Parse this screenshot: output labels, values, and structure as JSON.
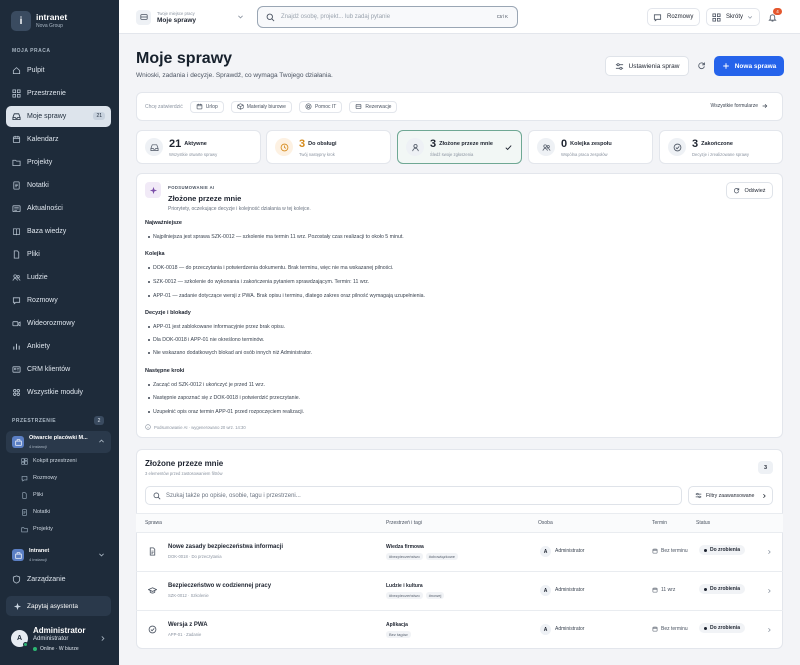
{
  "app": {
    "name": "intranet",
    "org": "Nova Group",
    "logo_letter": "i"
  },
  "sidebar": {
    "section_label": "MOJA PRACA",
    "items": [
      {
        "label": "Pulpit",
        "icon": "home-icon"
      },
      {
        "label": "Przestrzenie",
        "icon": "grid-icon"
      },
      {
        "label": "Moje sprawy",
        "icon": "inbox-icon",
        "count": "21",
        "active": true
      },
      {
        "label": "Kalendarz",
        "icon": "calendar-icon"
      },
      {
        "label": "Projekty",
        "icon": "folder-icon"
      },
      {
        "label": "Notatki",
        "icon": "note-icon"
      },
      {
        "label": "Aktualności",
        "icon": "news-icon"
      },
      {
        "label": "Baza wiedzy",
        "icon": "book-icon"
      },
      {
        "label": "Pliki",
        "icon": "file-icon"
      },
      {
        "label": "Ludzie",
        "icon": "people-icon"
      },
      {
        "label": "Rozmowy",
        "icon": "chat-icon"
      },
      {
        "label": "Wideorozmowy",
        "icon": "video-icon"
      },
      {
        "label": "Ankiety",
        "icon": "poll-icon"
      },
      {
        "label": "CRM klientów",
        "icon": "crm-icon"
      },
      {
        "label": "Wszystkie moduły",
        "icon": "modules-icon"
      }
    ],
    "spaces_label": "PRZESTRZENIE",
    "spaces_count": "2",
    "space1": {
      "name": "Otwarcie placówki M...",
      "instances": "4 instancji",
      "children": [
        "Kokpit przestrzeni",
        "Rozmowy",
        "Pliki",
        "Notatki",
        "Projekty"
      ]
    },
    "space2": {
      "name": "Intranet",
      "instances": "4 instancji"
    },
    "manage": "Zarządzanie",
    "assistant": "Zapytaj asystenta",
    "user": {
      "name": "Administrator",
      "role": "Administrator",
      "status": "Online · W biurze",
      "initial": "A"
    }
  },
  "topbar": {
    "workspace_label": "Twoje miejsce pracy",
    "workspace_value": "Moje sprawy",
    "search_placeholder": "Znajdź osobę, projekt... lub zadaj pytanie",
    "shortcut": "Ctrl K",
    "chats": "Rozmowy",
    "shortcuts": "Skróty",
    "notif_count": "4"
  },
  "page": {
    "title": "Moje sprawy",
    "subtitle": "Wnioski, zadania i decyzje. Sprawdź, co wymaga Twojego działania.",
    "settings_btn": "Ustawienia spraw",
    "new_btn": "Nowa sprawa"
  },
  "quick": {
    "label": "Chcę zatwierdzić",
    "chips": [
      "Urlop",
      "Materiały biurowe",
      "Pomoc IT",
      "Rezerwacje"
    ],
    "all_forms": "Wszystkie formularze"
  },
  "stats": [
    {
      "num": "21",
      "label": "Aktywne",
      "sub": "Wszystkie otwarte sprawy"
    },
    {
      "num": "3",
      "label": "Do obsługi",
      "sub": "Twój następny krok"
    },
    {
      "num": "3",
      "label": "Złożone przeze mnie",
      "sub": "Śledź swoje zgłoszenia"
    },
    {
      "num": "0",
      "label": "Kolejka zespołu",
      "sub": "Wspólna praca zespołów"
    },
    {
      "num": "3",
      "label": "Zakończone",
      "sub": "Decyzje i zrealizowane sprawy"
    }
  ],
  "ai": {
    "tag": "PODSUMOWANIE AI",
    "title": "Złożone przeze mnie",
    "subtitle": "Priorytety, oczekujące decyzje i kolejność działania w tej kolejce.",
    "refresh": "Odśwież",
    "sections": [
      {
        "heading": "Najważniejsze",
        "items": [
          "Najpilniejsza jest sprawa SZK-0012 — szkolenie ma termin 11 wrz. Pozostały czas realizacji to około 5 minut."
        ]
      },
      {
        "heading": "Kolejka",
        "items": [
          "DOK-0018 — do przeczytania i potwierdzenia dokumentu. Brak terminu, więc nie ma wskazanej pilności.",
          "SZK-0012 — szkolenie do wykonania i zakończenia pytaniem sprawdzającym. Termin: 11 wrz.",
          "APP-01 — zadanie dotyczące wersji z PWA. Brak opisu i terminu, dlatego zakres oraz pilność wymagają uzupełnienia."
        ]
      },
      {
        "heading": "Decyzje i blokady",
        "items": [
          "APP-01 jest zablokowane informacyjnie przez brak opisu.",
          "Dla DOK-0018 i APP-01 nie określono terminów.",
          "Nie wskazano dodatkowych blokad ani osób innych niż Administrator."
        ]
      },
      {
        "heading": "Następne kroki",
        "items": [
          "Zacząć od SZK-0012 i ukończyć je przed 11 wrz.",
          "Następnie zapoznać się z DOK-0018 i potwierdzić przeczytanie.",
          "Uzupełnić opis oraz termin APP-01 przed rozpoczęciem realizacji."
        ]
      }
    ],
    "footer": "Podsumowanie AI · wygenerowano 20 wrz. 14:30"
  },
  "list": {
    "title": "Złożone przeze mnie",
    "subtitle": "3 elementów przed zastosowaniem filtrów",
    "count": "3",
    "search_placeholder": "Szukaj także po opisie, osobie, tagu i przestrzeni...",
    "filters": "Filtry zaawansowane",
    "columns": [
      "Sprawa",
      "Przestrzeń i tagi",
      "Osoba",
      "Termin",
      "Status"
    ],
    "rows": [
      {
        "title": "Nowe zasady bezpieczeństwa informacji",
        "meta": "DOK-0018 · Do przeczytania",
        "space": "Wiedza firmowa",
        "tags": [
          "#bezpieczeństwo",
          "#obowiązkowe"
        ],
        "person": "Administrator",
        "initial": "A",
        "due": "Bez terminu",
        "status": "Do zrobienia",
        "icon": "document-icon"
      },
      {
        "title": "Bezpieczeństwo w codziennej pracy",
        "meta": "SZK-0012 · Szkolenie",
        "space": "Ludzie i kultura",
        "tags": [
          "#bezpieczeństwo",
          "#nowej"
        ],
        "person": "Administrator",
        "initial": "A",
        "due": "11 wrz",
        "status": "Do zrobienia",
        "icon": "graduation-icon"
      },
      {
        "title": "Wersja z PWA",
        "meta": "APP-01 · Zadanie",
        "space": "Aplikacja",
        "tags": [
          "Bez tagów"
        ],
        "person": "Administrator",
        "initial": "A",
        "due": "Bez terminu",
        "status": "Do zrobienia",
        "icon": "check-circle-icon"
      }
    ]
  }
}
